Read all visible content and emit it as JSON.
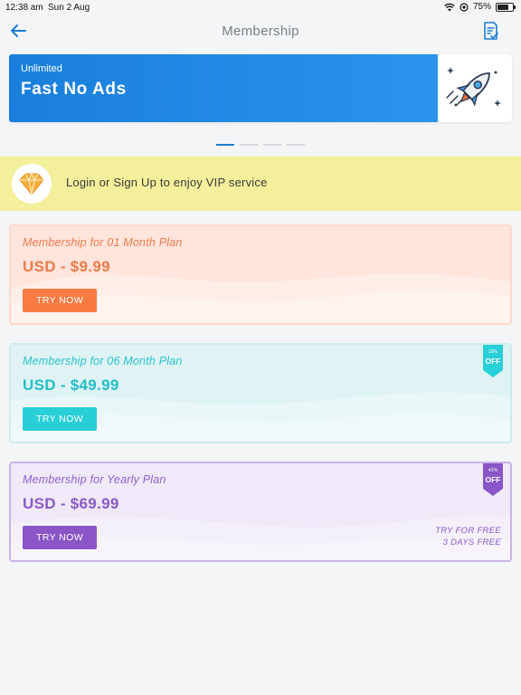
{
  "status_bar": {
    "time": "12:38 am",
    "date": "Sun 2 Aug",
    "battery": "75%",
    "battery_level": 0.75
  },
  "nav": {
    "title": "Membership",
    "back_icon": "arrow-left-icon",
    "right_icon": "checklist-icon"
  },
  "banner": {
    "eyebrow": "Unlimited",
    "headline": "Fast No Ads",
    "art_icon": "rocket-icon",
    "page_count": 4,
    "active_page": 1
  },
  "vip": {
    "text": "Login or Sign Up to enjoy VIP service",
    "icon": "diamond-icon"
  },
  "plans": [
    {
      "name": "Membership for 01 Month Plan",
      "price": "USD - $9.99",
      "button": "TRY NOW",
      "accent": "#f97b44"
    },
    {
      "name": "Membership for 06 Month Plan",
      "price": "USD - $49.99",
      "button": "TRY NOW",
      "accent": "#29cfd6",
      "badge_pct": "16%",
      "badge_off": "OFF"
    },
    {
      "name": "Membership for Yearly Plan",
      "price": "USD - $69.99",
      "button": "TRY NOW",
      "accent": "#8a55c6",
      "badge_pct": "41%",
      "badge_off": "OFF",
      "trial_line1": "TRY FOR FREE",
      "trial_line2": "3 DAYS FREE"
    }
  ]
}
